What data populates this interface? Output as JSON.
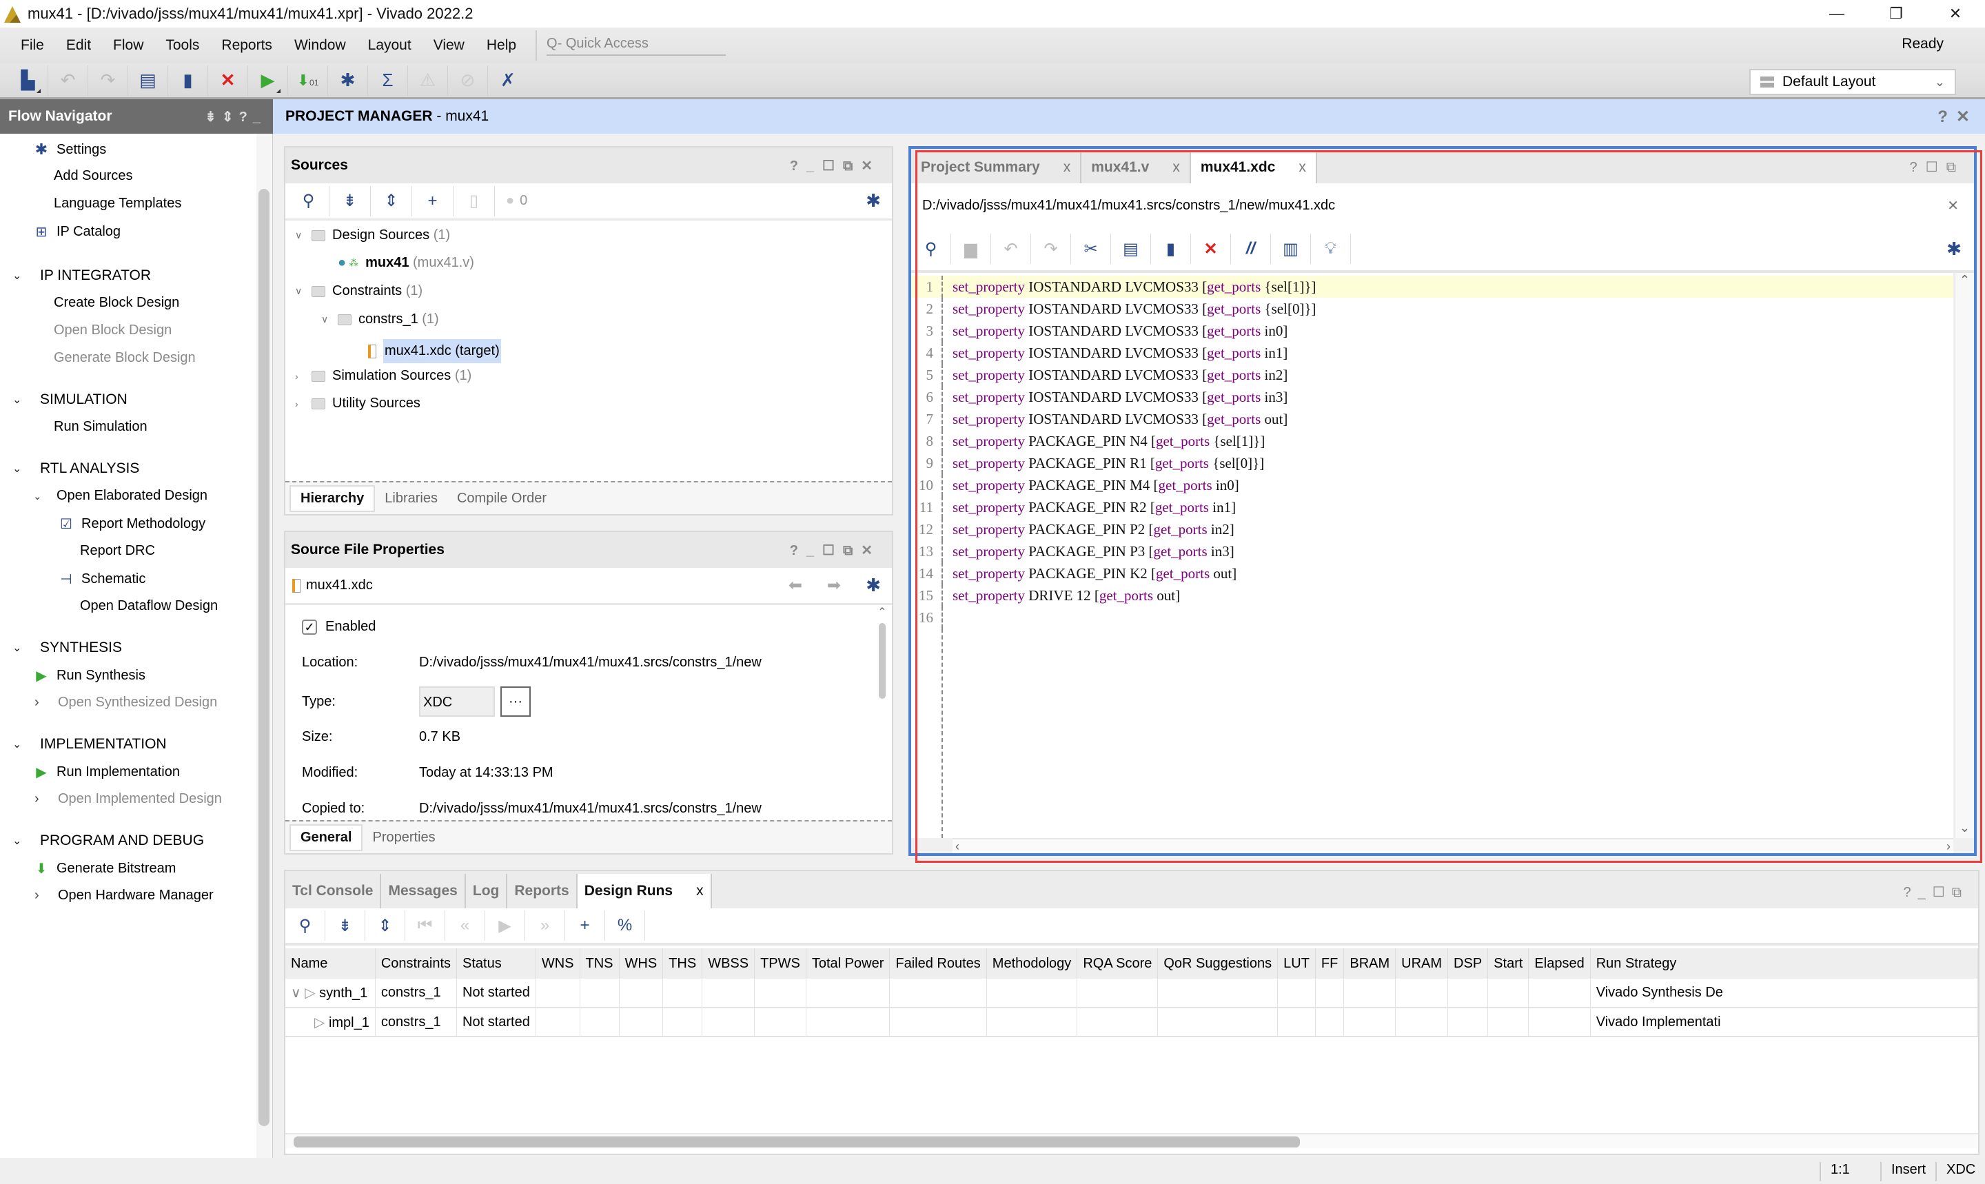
{
  "window": {
    "title": "mux41 - [D:/vivado/jsss/mux41/mux41/mux41.xpr] - Vivado 2022.2",
    "controls": {
      "minimize": "—",
      "restore": "❐",
      "close": "✕"
    }
  },
  "menubar": {
    "items": [
      "File",
      "Edit",
      "Flow",
      "Tools",
      "Reports",
      "Window",
      "Layout",
      "View",
      "Help"
    ],
    "quick_access_placeholder": "Q- Quick Access",
    "status": "Ready"
  },
  "toolbar": {
    "icons": [
      "open-project-icon",
      "undo-icon",
      "redo-icon",
      "copy-icon",
      "paste-icon",
      "delete-icon",
      "run-icon",
      "generate-bitstream-icon",
      "settings-icon",
      "sigma-icon",
      "disabled-tool-icon",
      "disabled-tool-icon-2",
      "cursor-icon"
    ],
    "layout_selector": "Default Layout"
  },
  "flow_navigator": {
    "title": "Flow Navigator",
    "items": [
      {
        "label": "Settings",
        "icon": "gear-icon",
        "level": 1,
        "enabled": true
      },
      {
        "label": "Add Sources",
        "level": 1,
        "enabled": true
      },
      {
        "label": "Language Templates",
        "level": 1,
        "enabled": true
      },
      {
        "label": "IP Catalog",
        "icon": "ip-catalog-icon",
        "level": 1,
        "enabled": true
      }
    ],
    "sections": [
      {
        "title": "IP INTEGRATOR",
        "items": [
          {
            "label": "Create Block Design",
            "enabled": true
          },
          {
            "label": "Open Block Design",
            "enabled": false
          },
          {
            "label": "Generate Block Design",
            "enabled": false
          }
        ]
      },
      {
        "title": "SIMULATION",
        "items": [
          {
            "label": "Run Simulation",
            "enabled": true
          }
        ]
      },
      {
        "title": "RTL ANALYSIS",
        "items": [
          {
            "label": "Open Elaborated Design",
            "enabled": true,
            "expanded": true
          },
          {
            "label": "Report Methodology",
            "enabled": true
          },
          {
            "label": "Report DRC",
            "enabled": true
          },
          {
            "label": "Schematic",
            "enabled": true
          },
          {
            "label": "Open Dataflow Design",
            "enabled": true
          }
        ]
      },
      {
        "title": "SYNTHESIS",
        "items": [
          {
            "label": "Run Synthesis",
            "enabled": true
          },
          {
            "label": "Open Synthesized Design",
            "enabled": false
          }
        ]
      },
      {
        "title": "IMPLEMENTATION",
        "items": [
          {
            "label": "Run Implementation",
            "enabled": true
          },
          {
            "label": "Open Implemented Design",
            "enabled": false
          }
        ]
      },
      {
        "title": "PROGRAM AND DEBUG",
        "items": [
          {
            "label": "Generate Bitstream",
            "enabled": true
          },
          {
            "label": "Open Hardware Manager",
            "enabled": true
          }
        ]
      }
    ]
  },
  "project_manager": {
    "title": "PROJECT MANAGER",
    "project": " - mux41"
  },
  "sources": {
    "title": "Sources",
    "warning_count": "0",
    "tree": [
      {
        "label": "Design Sources",
        "count": " (1)"
      },
      {
        "label": "mux41",
        "extra": " (mux41.v)"
      },
      {
        "label": "Constraints",
        "count": " (1)"
      },
      {
        "label": "constrs_1",
        "count": " (1)"
      },
      {
        "label": "mux41.xdc (target)"
      },
      {
        "label": "Simulation Sources",
        "count": " (1)"
      },
      {
        "label": "Utility Sources"
      }
    ],
    "tabs": [
      "Hierarchy",
      "Libraries",
      "Compile Order"
    ]
  },
  "source_file_properties": {
    "title": "Source File Properties",
    "file": "mux41.xdc",
    "enabled_label": "Enabled",
    "enabled": true,
    "rows": [
      {
        "key": "Location:",
        "value": "D:/vivado/jsss/mux41/mux41/mux41.srcs/constrs_1/new"
      },
      {
        "key": "Type:",
        "value": "XDC"
      },
      {
        "key": "Size:",
        "value": "0.7 KB"
      },
      {
        "key": "Modified:",
        "value": "Today at 14:33:13 PM"
      },
      {
        "key": "Copied to:",
        "value": "D:/vivado/jsss/mux41/mux41/mux41.srcs/constrs_1/new"
      }
    ],
    "type_browse": "···",
    "tabs": [
      "General",
      "Properties"
    ]
  },
  "editor": {
    "tabs": [
      {
        "label": "Project Summary",
        "active": false
      },
      {
        "label": "mux41.v",
        "active": false
      },
      {
        "label": "mux41.xdc",
        "active": true
      }
    ],
    "path": "D:/vivado/jsss/mux41/mux41/mux41.srcs/constrs_1/new/mux41.xdc",
    "lines": [
      {
        "n": "1",
        "cmd": "set_property",
        "args": " IOSTANDARD LVCMOS33 [",
        "fn": "get_ports",
        "rest": " {sel[1]}]"
      },
      {
        "n": "2",
        "cmd": "set_property",
        "args": " IOSTANDARD LVCMOS33 [",
        "fn": "get_ports",
        "rest": " {sel[0]}]"
      },
      {
        "n": "3",
        "cmd": "set_property",
        "args": " IOSTANDARD LVCMOS33 [",
        "fn": "get_ports",
        "rest": " in0]"
      },
      {
        "n": "4",
        "cmd": "set_property",
        "args": " IOSTANDARD LVCMOS33 [",
        "fn": "get_ports",
        "rest": " in1]"
      },
      {
        "n": "5",
        "cmd": "set_property",
        "args": " IOSTANDARD LVCMOS33 [",
        "fn": "get_ports",
        "rest": " in2]"
      },
      {
        "n": "6",
        "cmd": "set_property",
        "args": " IOSTANDARD LVCMOS33 [",
        "fn": "get_ports",
        "rest": " in3]"
      },
      {
        "n": "7",
        "cmd": "set_property",
        "args": " IOSTANDARD LVCMOS33 [",
        "fn": "get_ports",
        "rest": " out]"
      },
      {
        "n": "8",
        "cmd": "set_property",
        "args": " PACKAGE_PIN N4 [",
        "fn": "get_ports",
        "rest": " {sel[1]}]"
      },
      {
        "n": "9",
        "cmd": "set_property",
        "args": " PACKAGE_PIN R1 [",
        "fn": "get_ports",
        "rest": " {sel[0]}]"
      },
      {
        "n": "10",
        "cmd": "set_property",
        "args": " PACKAGE_PIN M4 [",
        "fn": "get_ports",
        "rest": " in0]"
      },
      {
        "n": "11",
        "cmd": "set_property",
        "args": " PACKAGE_PIN R2 [",
        "fn": "get_ports",
        "rest": " in1]"
      },
      {
        "n": "12",
        "cmd": "set_property",
        "args": " PACKAGE_PIN P2 [",
        "fn": "get_ports",
        "rest": " in2]"
      },
      {
        "n": "13",
        "cmd": "set_property",
        "args": " PACKAGE_PIN P3 [",
        "fn": "get_ports",
        "rest": " in3]"
      },
      {
        "n": "14",
        "cmd": "set_property",
        "args": " PACKAGE_PIN K2 [",
        "fn": "get_ports",
        "rest": " out]"
      },
      {
        "n": "15",
        "cmd": "set_property",
        "args": " DRIVE 12 [",
        "fn": "get_ports",
        "rest": " out]"
      },
      {
        "n": "16",
        "cmd": "",
        "args": "",
        "fn": "",
        "rest": ""
      }
    ]
  },
  "bottom_panel": {
    "tabs": [
      {
        "label": "Tcl Console",
        "active": false
      },
      {
        "label": "Messages",
        "active": false
      },
      {
        "label": "Log",
        "active": false
      },
      {
        "label": "Reports",
        "active": false
      },
      {
        "label": "Design Runs",
        "active": true
      }
    ],
    "columns": [
      "Name",
      "Constraints",
      "Status",
      "WNS",
      "TNS",
      "WHS",
      "THS",
      "WBSS",
      "TPWS",
      "Total Power",
      "Failed Routes",
      "Methodology",
      "RQA Score",
      "QoR Suggestions",
      "LUT",
      "FF",
      "BRAM",
      "URAM",
      "DSP",
      "Start",
      "Elapsed",
      "Run Strategy"
    ],
    "rows": [
      {
        "name": "synth_1",
        "constraints": "constrs_1",
        "status": "Not started",
        "strategy": "Vivado Synthesis De"
      },
      {
        "name": "impl_1",
        "constraints": "constrs_1",
        "status": "Not started",
        "strategy": "Vivado Implementati"
      }
    ]
  },
  "statusbar": {
    "position": "1:1",
    "mode": "Insert",
    "filetype": "XDC"
  },
  "colors": {
    "accent_blue": "#2b4a8a",
    "keyword": "#800080",
    "pm_header": "#cddefa",
    "selection": "#cddefa",
    "current_line": "#fdfdd8",
    "run_green": "#3aaa35",
    "delete_red": "#e02020"
  }
}
